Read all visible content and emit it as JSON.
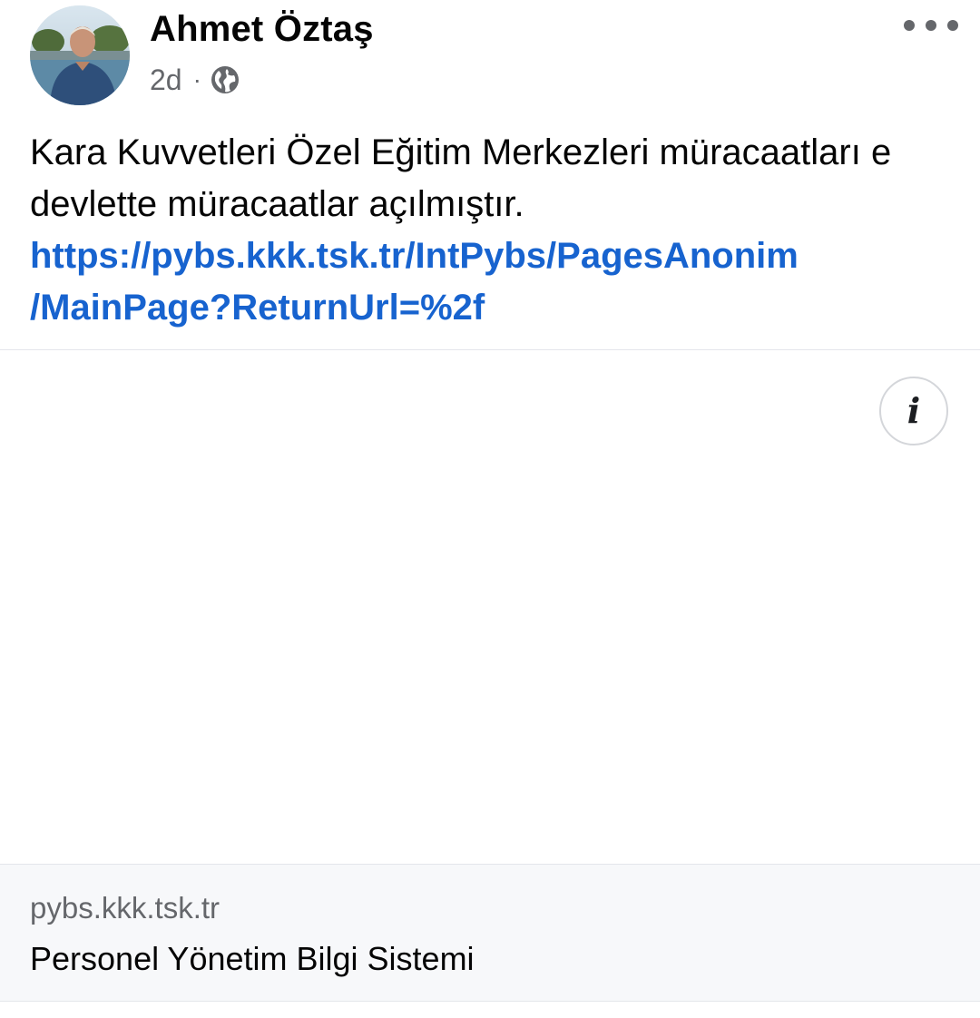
{
  "post": {
    "author_name": "Ahmet Öztaş",
    "timestamp": "2d",
    "separator": "·",
    "privacy_icon": "globe-icon",
    "more_icon": "more-horizontal-icon",
    "text": "Kara Kuvvetleri Özel Eğitim Merkezleri müracaatları e devlette müracaatlar açılmıştır.",
    "link_url_line1": "https://pybs.kkk.tsk.tr/IntPybs/PagesAnonim",
    "link_url_line2": "/MainPage?ReturnUrl=%2f"
  },
  "link_preview": {
    "info_icon": "info-icon",
    "info_glyph": "i",
    "domain": "pybs.kkk.tsk.tr",
    "title": "Personel Yönetim Bilgi Sistemi"
  },
  "colors": {
    "link": "#1763cf",
    "secondary_text": "#65676b",
    "caption_bg": "#f7f8fa"
  }
}
